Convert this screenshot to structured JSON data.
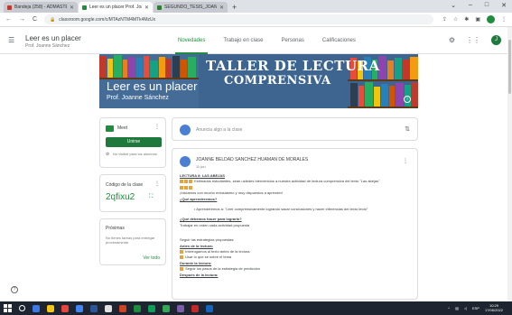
{
  "browser": {
    "tabs": [
      {
        "title": "Bandeja (258) - ADMASTEst@...",
        "color": "#c0392b",
        "active": false
      },
      {
        "title": "Leer es un placer Prof. Joanne S...",
        "color": "#1e8e3e",
        "active": true
      },
      {
        "title": "SEGUNDO_TESIS_JOANNE_SAN...",
        "color": "#2e7d32",
        "active": false
      }
    ],
    "new_tab": "+",
    "url": "classroom.google.com/c/MTAzNTM4MTk4MzUx",
    "window_controls": [
      "⌄",
      "–",
      "□",
      "✕"
    ]
  },
  "classroom": {
    "title": "Leer es un placer",
    "subtitle": "Prof. Joanne Sánchez",
    "nav": [
      "Novedades",
      "Trabajo en clase",
      "Personas",
      "Calificaciones"
    ],
    "nav_active": 0,
    "avatar_letter": "J"
  },
  "banner": {
    "art_line1": "TALLER DE LECTURA",
    "art_line2": "COMPRENSIVA",
    "title": "Leer es un placer",
    "teacher": "Prof. Joanne Sánchez",
    "info": "i"
  },
  "meet": {
    "label": "Meet",
    "join": "Unirse",
    "note": "No visible para los alumnos"
  },
  "class_code": {
    "label": "Código de la clase",
    "value": "2qfixu2",
    "fullscreen": "⛶"
  },
  "upcoming": {
    "label": "Próximas",
    "text": "No tienes tareas para entregar próximamente",
    "link": "Ver todo"
  },
  "announce": {
    "placeholder": "Anuncia algo a la clase"
  },
  "post": {
    "author": "JOANNE BELDAD SANCHEZ HUAMAN DE MORALES",
    "time": "11 jun",
    "lines": [
      {
        "text": "LECTURA 8: LAS ABEJAS",
        "style": "b"
      },
      {
        "text": "Estimados estudiantes, sean ustedes bienvenidos a nuestra actividad de lectura comprensiva del texto \"Las abejas\"",
        "style": "em"
      },
      {
        "text": "",
        "style": "em2"
      },
      {
        "text": "¡Iniciamos con mucho entusiasmo y muy dispuestos a aprender!",
        "style": ""
      },
      {
        "text": "¿Qué aprenderemos?",
        "style": "b"
      },
      {
        "text": "",
        "style": "gap"
      },
      {
        "text": "•  Aprenderemos a: \"Leer comprensivamente logrando sacar conclusiones y hacer inferencias del texto leído\"",
        "style": "ind"
      },
      {
        "text": "",
        "style": "gap"
      },
      {
        "text": "¿Qué debemos hacer para lograrlo?",
        "style": "b"
      },
      {
        "text": "Trabajar en orden cada actividad propuesta",
        "style": ""
      },
      {
        "text": "",
        "style": "gap"
      },
      {
        "text": "",
        "style": "gap"
      },
      {
        "text": "Seguir las estrategias propuestas:",
        "style": ""
      },
      {
        "text": "Antes de la lectura:",
        "style": "b"
      },
      {
        "text": "Interrogamos al texto antes de la lectura",
        "style": "em"
      },
      {
        "text": "Usar lo que sé sobre el tema",
        "style": "em"
      },
      {
        "text": "Durante la lectura:",
        "style": "b"
      },
      {
        "text": "Seguir los pasos de la estrategia de predicción",
        "style": "em"
      },
      {
        "text": "Después de la lectura:",
        "style": "b"
      }
    ]
  },
  "taskbar": {
    "lang": "ESP",
    "time": "10:29",
    "date": "17/06/2022",
    "icons": [
      "#3b7be8",
      "#f5c518",
      "#e8453c",
      "#4285f4",
      "#2b579a",
      "#e0e0e0",
      "#d04423",
      "#1e8e3e",
      "#0f9d58",
      "#34a853",
      "#7b5ea7",
      "#c62828",
      "#1565c0"
    ]
  }
}
